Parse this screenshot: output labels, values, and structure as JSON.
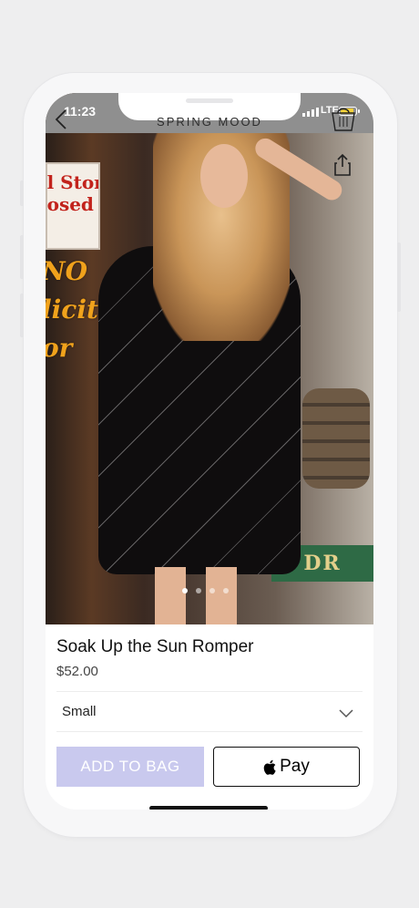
{
  "status_bar": {
    "time": "11:23",
    "network": "LTE"
  },
  "header": {
    "title": "SPRING MOOD"
  },
  "product": {
    "name": "Soak Up the Sun Romper",
    "price": "$52.00",
    "image_count": 4,
    "active_image": 1
  },
  "photo": {
    "store_sign_text": "il Store\nlosed",
    "window_text": "NO\nlicitin\nor",
    "shop_sign_text": "DR"
  },
  "size_select": {
    "selected": "Small"
  },
  "actions": {
    "add_to_bag": "ADD TO BAG",
    "apple_pay": "Pay"
  },
  "colors": {
    "add_to_bag_bg": "#c9c9ee",
    "battery": "#f7d23a",
    "status_bar_bg": "#8f8f8f"
  }
}
